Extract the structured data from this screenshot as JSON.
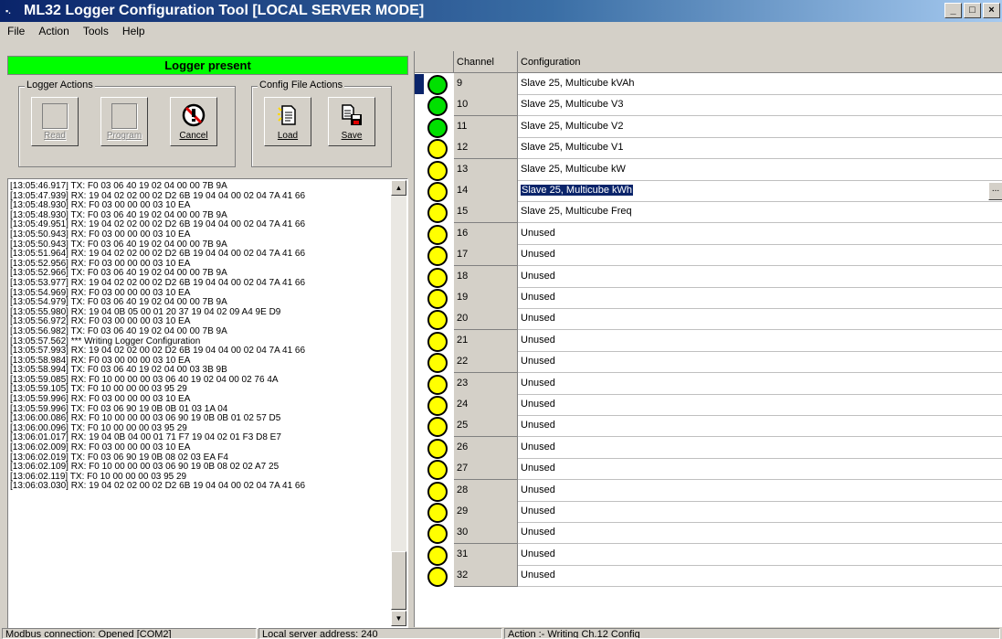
{
  "window": {
    "title": "ML32 Logger Configuration Tool [LOCAL SERVER MODE]",
    "controls": [
      "_",
      "□",
      "×"
    ]
  },
  "menu": [
    "File",
    "Action",
    "Tools",
    "Help"
  ],
  "logger_status": {
    "text": "Logger present",
    "color": "#00ff00"
  },
  "logger_actions": {
    "label": "Logger Actions",
    "buttons": [
      {
        "label": "Read",
        "enabled": false
      },
      {
        "label": "Program",
        "enabled": false
      },
      {
        "label": "Cancel",
        "enabled": true,
        "icon": "cancel-stop-icon"
      }
    ]
  },
  "config_file_actions": {
    "label": "Config File Actions",
    "buttons": [
      {
        "label": "Load",
        "icon": "load-file-icon"
      },
      {
        "label": "Save",
        "icon": "save-file-icon"
      }
    ]
  },
  "log": [
    "[13:05:46.917] TX: F0 03 06 40 19 02 04 00 00 7B 9A",
    "[13:05:47.939] RX: 19 04 02 02 00 02 D2 6B 19 04 04 00 02 04 7A 41 66",
    "[13:05:48.930] RX: F0 03 00 00 00 03 10 EA",
    "[13:05:48.930] TX: F0 03 06 40 19 02 04 00 00 7B 9A",
    "[13:05:49.951] RX: 19 04 02 02 00 02 D2 6B 19 04 04 00 02 04 7A 41 66",
    "[13:05:50.943] RX: F0 03 00 00 00 03 10 EA",
    "[13:05:50.943] TX: F0 03 06 40 19 02 04 00 00 7B 9A",
    "[13:05:51.964] RX: 19 04 02 02 00 02 D2 6B 19 04 04 00 02 04 7A 41 66",
    "[13:05:52.956] RX: F0 03 00 00 00 03 10 EA",
    "[13:05:52.966] TX: F0 03 06 40 19 02 04 00 00 7B 9A",
    "[13:05:53.977] RX: 19 04 02 02 00 02 D2 6B 19 04 04 00 02 04 7A 41 66",
    "[13:05:54.969] RX: F0 03 00 00 00 03 10 EA",
    "[13:05:54.979] TX: F0 03 06 40 19 02 04 00 00 7B 9A",
    "[13:05:55.980] RX: 19 04 0B 05 00 01 20 37 19 04 02 09 A4 9E D9",
    "[13:05:56.972] RX: F0 03 00 00 00 03 10 EA",
    "[13:05:56.982] TX: F0 03 06 40 19 02 04 00 00 7B 9A",
    "[13:05:57.562] *** Writing Logger Configuration",
    "[13:05:57.993] RX: 19 04 02 02 00 02 D2 6B 19 04 04 00 02 04 7A 41 66",
    "[13:05:58.984] RX: F0 03 00 00 00 03 10 EA",
    "[13:05:58.994] TX: F0 03 06 40 19 02 04 00 03 3B 9B",
    "[13:05:59.085] RX: F0 10 00 00 00 03 06 40 19 02 04 00 02 76 4A",
    "[13:05:59.105] TX: F0 10 00 00 00 03 95 29",
    "[13:05:59.996] RX: F0 03 00 00 00 03 10 EA",
    "[13:05:59.996] TX: F0 03 06 90 19 0B 0B 01 03 1A 04",
    "[13:06:00.086] RX: F0 10 00 00 00 03 06 90 19 0B 0B 01 02 57 D5",
    "[13:06:00.096] TX: F0 10 00 00 00 03 95 29",
    "[13:06:01.017] RX: 19 04 0B 04 00 01 71 F7 19 04 02 01 F3 D8 E7",
    "[13:06:02.009] RX: F0 03 00 00 00 03 10 EA",
    "[13:06:02.019] TX: F0 03 06 90 19 0B 08 02 03 EA F4",
    "[13:06:02.109] RX: F0 10 00 00 00 03 06 90 19 0B 08 02 02 A7 25",
    "[13:06:02.119] TX: F0 10 00 00 00 03 95 29",
    "[13:06:03.030] RX: 19 04 02 02 00 02 D2 6B 19 04 04 00 02 04 7A 41 66"
  ],
  "grid": {
    "headers": {
      "channel": "Channel",
      "configuration": "Configuration"
    },
    "rows": [
      {
        "channel": "9",
        "config": "Slave 25, Multicube kVAh",
        "status": "green",
        "current": true
      },
      {
        "channel": "10",
        "config": "Slave 25, Multicube V3",
        "status": "green"
      },
      {
        "channel": "11",
        "config": "Slave 25, Multicube V2",
        "status": "green"
      },
      {
        "channel": "12",
        "config": "Slave 25, Multicube V1",
        "status": "yellow"
      },
      {
        "channel": "13",
        "config": "Slave 25, Multicube kW",
        "status": "yellow"
      },
      {
        "channel": "14",
        "config": "Slave 25, Multicube kWh",
        "status": "yellow",
        "selected": true
      },
      {
        "channel": "15",
        "config": "Slave 25, Multicube Freq",
        "status": "yellow"
      },
      {
        "channel": "16",
        "config": "Unused",
        "status": "yellow"
      },
      {
        "channel": "17",
        "config": "Unused",
        "status": "yellow"
      },
      {
        "channel": "18",
        "config": "Unused",
        "status": "yellow"
      },
      {
        "channel": "19",
        "config": "Unused",
        "status": "yellow"
      },
      {
        "channel": "20",
        "config": "Unused",
        "status": "yellow"
      },
      {
        "channel": "21",
        "config": "Unused",
        "status": "yellow"
      },
      {
        "channel": "22",
        "config": "Unused",
        "status": "yellow"
      },
      {
        "channel": "23",
        "config": "Unused",
        "status": "yellow"
      },
      {
        "channel": "24",
        "config": "Unused",
        "status": "yellow"
      },
      {
        "channel": "25",
        "config": "Unused",
        "status": "yellow"
      },
      {
        "channel": "26",
        "config": "Unused",
        "status": "yellow"
      },
      {
        "channel": "27",
        "config": "Unused",
        "status": "yellow"
      },
      {
        "channel": "28",
        "config": "Unused",
        "status": "yellow"
      },
      {
        "channel": "29",
        "config": "Unused",
        "status": "yellow"
      },
      {
        "channel": "30",
        "config": "Unused",
        "status": "yellow"
      },
      {
        "channel": "31",
        "config": "Unused",
        "status": "yellow"
      },
      {
        "channel": "32",
        "config": "Unused",
        "status": "yellow"
      }
    ],
    "edit_button": "..."
  },
  "status_colors": {
    "green": "#00e000",
    "yellow": "#ffff00"
  },
  "statusbar": {
    "connection": "Modbus connection: Opened [COM2]",
    "address": "Local server address: 240",
    "action": "Action :- Writing Ch.12 Config"
  }
}
